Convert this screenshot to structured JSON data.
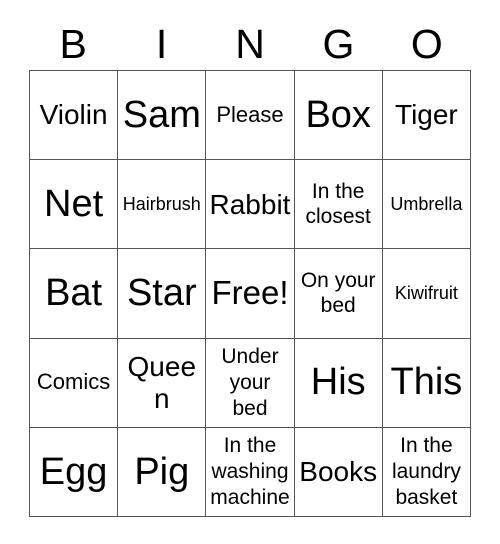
{
  "card": {
    "title": "BINGO",
    "columns": 5,
    "rows": 5,
    "border_color": "#555555",
    "text_color": "#000000",
    "background_color": "#ffffff"
  },
  "header": {
    "letters": [
      {
        "label": "B"
      },
      {
        "label": "I"
      },
      {
        "label": "N"
      },
      {
        "label": "G"
      },
      {
        "label": "O"
      }
    ]
  },
  "grid": {
    "cells": [
      {
        "text": "Violin",
        "size": "fs-md",
        "free": false
      },
      {
        "text": "Sam",
        "size": "fs-xl",
        "free": false
      },
      {
        "text": "Please",
        "size": "fs-sm",
        "free": false
      },
      {
        "text": "Box",
        "size": "fs-xl",
        "free": false
      },
      {
        "text": "Tiger",
        "size": "fs-md",
        "free": false
      },
      {
        "text": "Net",
        "size": "fs-xl",
        "free": false
      },
      {
        "text": "Hairbrush",
        "size": "fs-xs",
        "free": false
      },
      {
        "text": "Rabbit",
        "size": "fs-md",
        "free": false
      },
      {
        "text": "In the closest",
        "size": "fs-wrap",
        "free": false
      },
      {
        "text": "Umbrella",
        "size": "fs-xs",
        "free": false
      },
      {
        "text": "Bat",
        "size": "fs-xl",
        "free": false
      },
      {
        "text": "Star",
        "size": "fs-xl",
        "free": false
      },
      {
        "text": "Free!",
        "size": "fs-lg",
        "free": true
      },
      {
        "text": "On your bed",
        "size": "fs-wrap",
        "free": false
      },
      {
        "text": "Kiwifruit",
        "size": "fs-xs",
        "free": false
      },
      {
        "text": "Comics",
        "size": "fs-sm",
        "free": false
      },
      {
        "text": "Queen",
        "size": "fs-md",
        "free": false
      },
      {
        "text": "Under your bed",
        "size": "fs-wrap",
        "free": false
      },
      {
        "text": "His",
        "size": "fs-xl",
        "free": false
      },
      {
        "text": "This",
        "size": "fs-xl",
        "free": false
      },
      {
        "text": "Egg",
        "size": "fs-xl",
        "free": false
      },
      {
        "text": "Pig",
        "size": "fs-xl",
        "free": false
      },
      {
        "text": "In the washing machine",
        "size": "fs-wrap",
        "free": false
      },
      {
        "text": "Books",
        "size": "fs-md",
        "free": false
      },
      {
        "text": "In the laundry basket",
        "size": "fs-wrap",
        "free": false
      }
    ]
  }
}
